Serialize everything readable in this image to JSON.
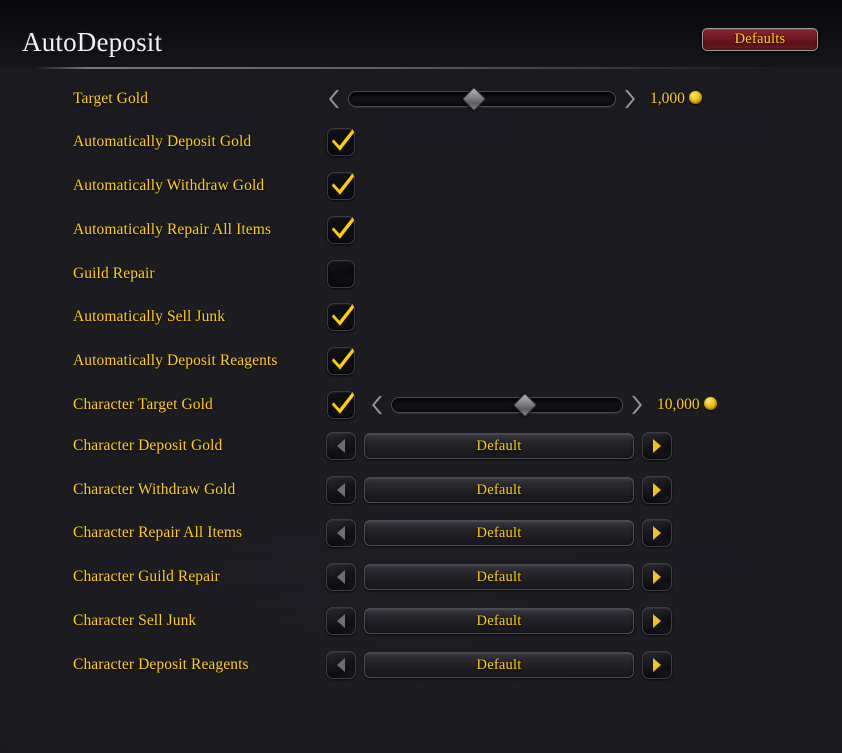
{
  "header": {
    "title": "AutoDeposit",
    "defaults_label": "Defaults"
  },
  "rows": [
    {
      "label": "Target Gold",
      "type": "slider",
      "value": "1,000",
      "currency_icon": "gold-coin-icon",
      "thumb_percent": 47
    },
    {
      "label": "Automatically Deposit Gold",
      "type": "checkbox",
      "checked": true
    },
    {
      "label": "Automatically Withdraw Gold",
      "type": "checkbox",
      "checked": true
    },
    {
      "label": "Automatically Repair All Items",
      "type": "checkbox",
      "checked": true
    },
    {
      "label": "Guild Repair",
      "type": "checkbox",
      "checked": false
    },
    {
      "label": "Automatically Sell Junk",
      "type": "checkbox",
      "checked": true
    },
    {
      "label": "Automatically Deposit Reagents",
      "type": "checkbox",
      "checked": true
    },
    {
      "label": "Character Target Gold",
      "type": "checkbox-slider",
      "checked": true,
      "value": "10,000",
      "currency_icon": "gold-coin-icon",
      "thumb_percent": 58
    },
    {
      "label": "Character Deposit Gold",
      "type": "dropdown",
      "value": "Default",
      "prev_icon": "arrow-left-icon",
      "next_icon": "arrow-right-icon"
    },
    {
      "label": "Character Withdraw Gold",
      "type": "dropdown",
      "value": "Default",
      "prev_icon": "arrow-left-icon",
      "next_icon": "arrow-right-icon"
    },
    {
      "label": "Character Repair All Items",
      "type": "dropdown",
      "value": "Default",
      "prev_icon": "arrow-left-icon",
      "next_icon": "arrow-right-icon"
    },
    {
      "label": "Character Guild Repair",
      "type": "dropdown",
      "value": "Default",
      "prev_icon": "arrow-left-icon",
      "next_icon": "arrow-right-icon"
    },
    {
      "label": "Character Sell Junk",
      "type": "dropdown",
      "value": "Default",
      "prev_icon": "arrow-left-icon",
      "next_icon": "arrow-right-icon"
    },
    {
      "label": "Character Deposit Reagents",
      "type": "dropdown",
      "value": "Default",
      "prev_icon": "arrow-left-icon",
      "next_icon": "arrow-right-icon"
    }
  ],
  "colors": {
    "background": "#1b1b20",
    "header_background": "#0e0e12",
    "label_gold": "#ffd100",
    "title_white": "#f2f2f2",
    "defaults_red": "#7a1d27",
    "arrow_active_gold": "#f2c21b",
    "arrow_inactive_gray": "#6d6d74"
  }
}
